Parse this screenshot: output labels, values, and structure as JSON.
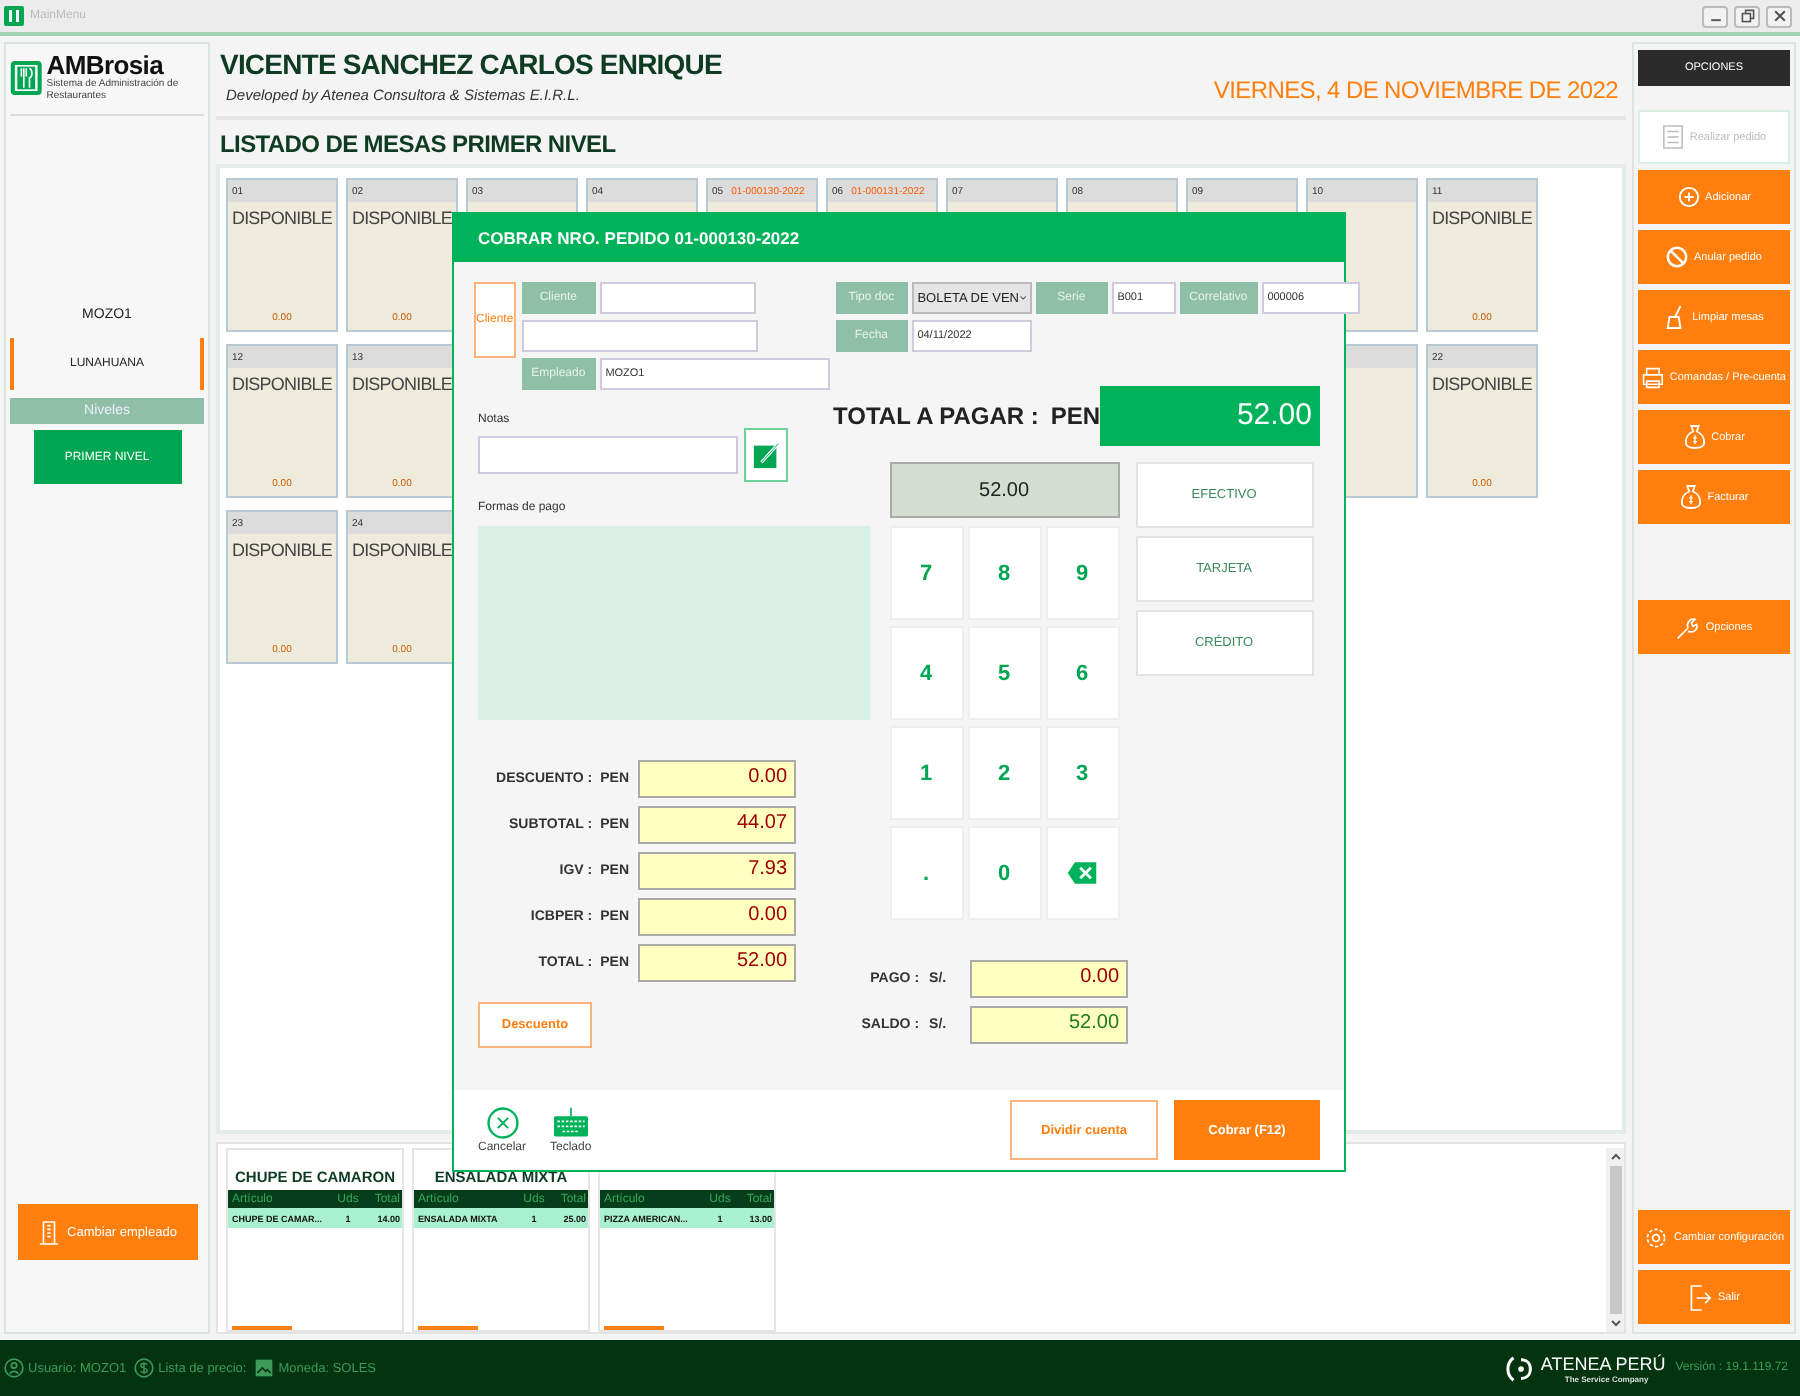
{
  "window": {
    "title": "MainMenu"
  },
  "sidebar": {
    "logo": "AMBrosia",
    "logo_tagline": "Sistema de Administración de Restaurantes",
    "employee": "MOZO1",
    "location": "LUNAHUANA",
    "levels_title": "Niveles",
    "levels": [
      {
        "label": "PRIMER NIVEL",
        "selected": true
      }
    ],
    "footer_button": "Cambiar empleado"
  },
  "header": {
    "name": "VICENTE SANCHEZ CARLOS ENRIQUE",
    "developer": "Developed by Atenea Consultora & Sistemas E.I.R.L.",
    "date": "VIERNES, 4 DE NOVIEMBRE DE 2022"
  },
  "tables": {
    "title": "LISTADO DE MESAS PRIMER NIVEL",
    "rows": [
      [
        {
          "number": "01",
          "status": "DISPONIBLE",
          "amount": "0.00"
        },
        {
          "number": "02",
          "status": "DISPONIBLE",
          "amount": "0.00"
        },
        {
          "number": "03"
        },
        {
          "number": "04"
        },
        {
          "number": "05",
          "order": "01-000130-2022"
        },
        {
          "number": "06",
          "order": "01-000131-2022"
        },
        {
          "number": "07"
        },
        {
          "number": "08"
        },
        {
          "number": "09"
        },
        {
          "number": "10"
        },
        {
          "number": "11",
          "status": "DISPONIBLE",
          "amount": "0.00"
        }
      ],
      [
        {
          "number": "12",
          "status": "DISPONIBLE",
          "amount": "0.00"
        },
        {
          "number": "13",
          "status": "DISPONIBLE",
          "amount": "0.00"
        },
        {},
        {},
        {},
        {},
        {},
        {},
        {},
        {},
        {
          "number": "22",
          "status": "DISPONIBLE",
          "amount": "0.00"
        }
      ],
      [
        {
          "number": "23",
          "status": "DISPONIBLE",
          "amount": "0.00"
        },
        {
          "number": "24",
          "status": "DISPONIBLE",
          "amount": "0.00"
        }
      ]
    ]
  },
  "orders": [
    {
      "title": "CHUPE DE CAMARON",
      "columns": [
        "Artículo",
        "Uds",
        "Total"
      ],
      "items": [
        {
          "name": "CHUPE DE CAMAR...",
          "qty": "1",
          "total": "14.00"
        }
      ]
    },
    {
      "title": "ENSALADA MIXTA",
      "columns": [
        "Artículo",
        "Uds",
        "Total"
      ],
      "items": [
        {
          "name": "ENSALADA MIXTA",
          "qty": "1",
          "total": "25.00"
        }
      ]
    },
    {
      "columns": [
        "Artículo",
        "Uds",
        "Total"
      ],
      "items": [
        {
          "name": "PIZZA AMERICAN...",
          "qty": "1",
          "total": "13.00"
        }
      ]
    }
  ],
  "options": {
    "title": "OPCIONES",
    "items": [
      {
        "label": "Realizar pedido",
        "kind": "list",
        "disabled": true
      },
      {
        "label": "Adicionar",
        "kind": "plus",
        "disabled": false
      },
      {
        "label": "Anular pedido",
        "kind": "ban",
        "disabled": false
      },
      {
        "label": "Limpiar mesas",
        "kind": "broom",
        "disabled": false
      },
      {
        "label": "Comandas / Pre-cuenta",
        "kind": "printer",
        "disabled": false
      },
      {
        "label": "Cobrar",
        "kind": "moneybag",
        "disabled": false
      },
      {
        "label": "Facturar",
        "kind": "moneybag",
        "disabled": false
      }
    ],
    "extra": [
      {
        "label": "Opciones",
        "kind": "wrench",
        "disabled": false
      }
    ],
    "footer": [
      {
        "label": "Cambiar configuración",
        "kind": "gear",
        "disabled": false
      },
      {
        "label": "Salir",
        "kind": "exit",
        "disabled": false
      }
    ]
  },
  "status_bar": {
    "items": [
      {
        "kind": "user",
        "text": "Usuario: MOZO1"
      },
      {
        "kind": "dollar",
        "text": "Lista de precio:"
      },
      {
        "kind": "picture",
        "text": "Moneda: SOLES"
      }
    ],
    "brand": "ATENEA PERÚ",
    "brand_tagline": "The Service Company",
    "version": "Versión : 19.1.119.72"
  },
  "dialog": {
    "title": "COBRAR NRO. PEDIDO 01-000130-2022",
    "client_button": "Cliente",
    "client_label": "Cliente",
    "doc_type_label": "Tipo doc",
    "doc_type_value": "BOLETA DE VEN",
    "series_label": "Serie",
    "series_value": "B001",
    "number_label": "Correlativo",
    "number_value": "000006",
    "date_label": "Fecha",
    "date_value": "04/11/2022",
    "employee_label": "Empleado",
    "employee_value": "MOZO1",
    "notes_label": "Notas",
    "payment_methods_label": "Formas de pago",
    "total_label": "TOTAL A PAGAR :",
    "total_currency": "PEN",
    "total_value": "52.00",
    "display": "52.00",
    "keys": [
      {
        "kind": "digit",
        "label": "7"
      },
      {
        "kind": "digit",
        "label": "8"
      },
      {
        "kind": "digit",
        "label": "9"
      },
      {
        "kind": "digit",
        "label": "4"
      },
      {
        "kind": "digit",
        "label": "5"
      },
      {
        "kind": "digit",
        "label": "6"
      },
      {
        "kind": "digit",
        "label": "1"
      },
      {
        "kind": "digit",
        "label": "2"
      },
      {
        "kind": "digit",
        "label": "3"
      },
      {
        "kind": "digit",
        "label": "."
      },
      {
        "kind": "digit",
        "label": "0"
      },
      {
        "kind": "backspace"
      }
    ],
    "methods": [
      "EFECTIVO",
      "TARJETA",
      "CRÉDITO"
    ],
    "summary": [
      {
        "label": "DESCUENTO :",
        "currency": "PEN",
        "value": "0.00"
      },
      {
        "label": "SUBTOTAL :",
        "currency": "PEN",
        "value": "44.07"
      },
      {
        "label": "IGV :",
        "currency": "PEN",
        "value": "7.93"
      },
      {
        "label": "ICBPER :",
        "currency": "PEN",
        "value": "0.00"
      },
      {
        "label": "TOTAL :",
        "currency": "PEN",
        "value": "52.00"
      }
    ],
    "discount_button": "Descuento",
    "payment": [
      {
        "label": "PAGO :",
        "currency": "S/.",
        "value": "0.00",
        "color": "#a00000"
      },
      {
        "label": "SALDO :",
        "currency": "S/.",
        "value": "52.00",
        "color": "#1f7a1f"
      }
    ],
    "actions": [
      {
        "label": "Cancelar",
        "kind": "cancel"
      },
      {
        "label": "Teclado",
        "kind": "keyboard"
      }
    ],
    "buttons": [
      {
        "label": "Dividir cuenta",
        "kind": "outline"
      },
      {
        "label": "Cobrar (F12)",
        "kind": "primary"
      }
    ]
  }
}
